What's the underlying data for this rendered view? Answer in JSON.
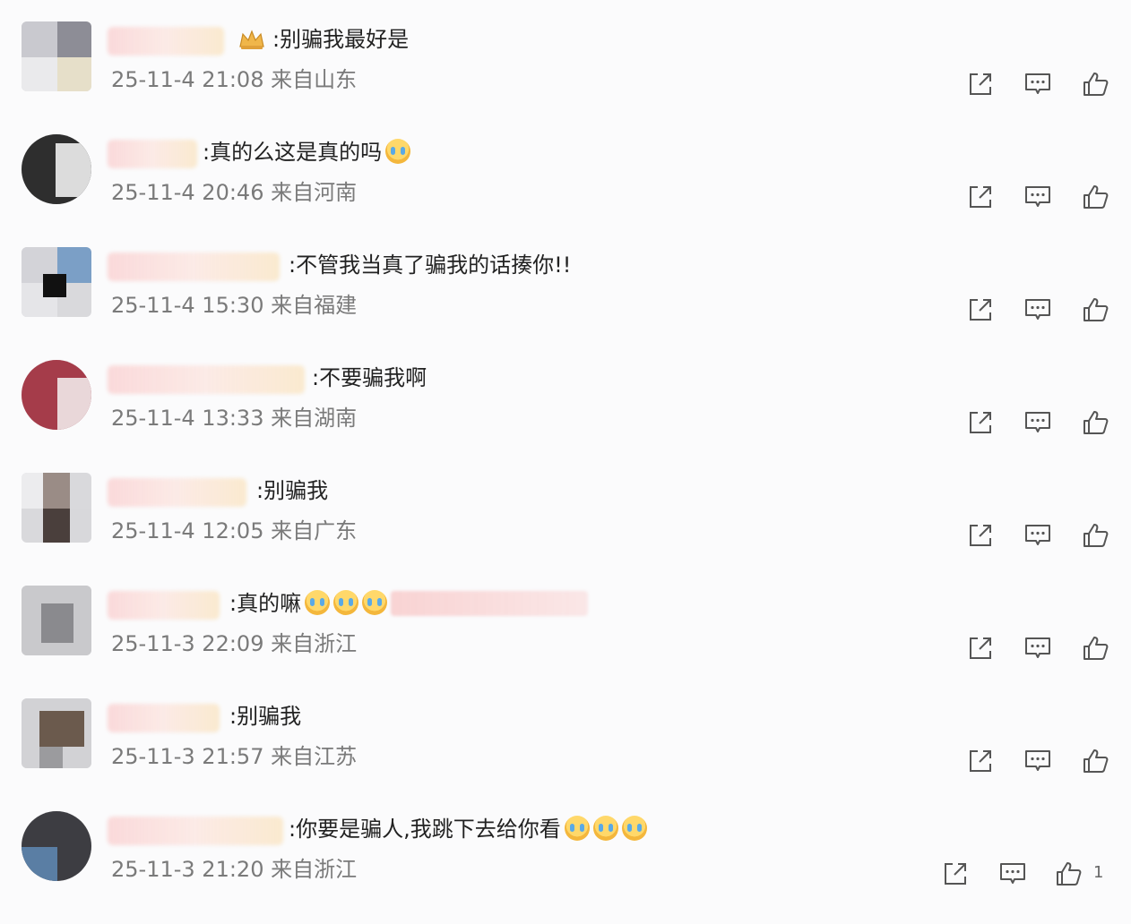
{
  "comments": [
    {
      "text": ":别骗我最好是",
      "meta": "25-11-4 21:08 来自山东"
    },
    {
      "text": ":真的么这是真的吗",
      "meta": "25-11-4 20:46 来自河南"
    },
    {
      "text": ":不管我当真了骗我的话揍你!!",
      "meta": "25-11-4 15:30 来自福建"
    },
    {
      "text": ":不要骗我啊",
      "meta": "25-11-4 13:33 来自湖南"
    },
    {
      "text": ":别骗我",
      "meta": "25-11-4 12:05 来自广东"
    },
    {
      "text": ":真的嘛",
      "meta": "25-11-3 22:09 来自浙江"
    },
    {
      "text": ":别骗我",
      "meta": "25-11-3 21:57 来自江苏"
    },
    {
      "text": ":你要是骗人,我跳下去给你看",
      "meta": "25-11-3 21:20 来自浙江",
      "like_count": "1"
    }
  ],
  "icons": {
    "share": "share-icon",
    "reply": "comment-icon",
    "like": "thumbs-up-icon",
    "emoji": "crying-face-emoji",
    "badge": "crown-icon"
  },
  "colors": {
    "meta_text": "#7a7a7a",
    "icon_stroke": "#555555",
    "name_blur": "#f6c1bd"
  }
}
